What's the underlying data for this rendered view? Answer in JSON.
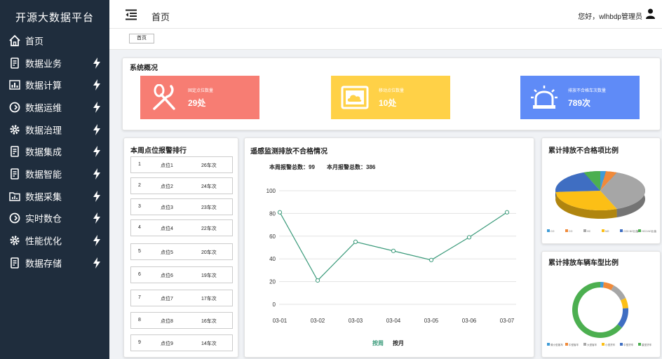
{
  "app": {
    "title": "开源大数据平台"
  },
  "sidebar": {
    "items": [
      {
        "label": "首页",
        "icon": "home-icon"
      },
      {
        "label": "数据业务",
        "icon": "document-icon"
      },
      {
        "label": "数据计算",
        "icon": "bar-chart-icon"
      },
      {
        "label": "数据运维",
        "icon": "refresh-icon"
      },
      {
        "label": "数据治理",
        "icon": "gear-icon"
      },
      {
        "label": "数据集成",
        "icon": "document-icon"
      },
      {
        "label": "数据智能",
        "icon": "document-icon"
      },
      {
        "label": "数据采集",
        "icon": "folder-chart-icon"
      },
      {
        "label": "实时数仓",
        "icon": "refresh-icon"
      },
      {
        "label": "性能优化",
        "icon": "gear-icon"
      },
      {
        "label": "数据存储",
        "icon": "document-icon"
      }
    ]
  },
  "header": {
    "title": "首页",
    "greeting": "您好，wlhbdp管理员"
  },
  "tagbar": {
    "tab": "首页"
  },
  "overview": {
    "title": "系统概况",
    "cards": [
      {
        "label": "固定点位数量",
        "value": "29处",
        "color": "#f77d73",
        "icon": "spoon-knife-icon"
      },
      {
        "label": "移动点位数量",
        "value": "10处",
        "color": "#ffd147",
        "icon": "cloud-screen-icon"
      },
      {
        "label": "排放不合格车次数量",
        "value": "789次",
        "color": "#5f8bf7",
        "icon": "alarm-light-icon"
      }
    ]
  },
  "ranking": {
    "title": "本周点位报警排行",
    "rows": [
      {
        "no": "1",
        "name": "点位1",
        "value": "26车次"
      },
      {
        "no": "2",
        "name": "点位2",
        "value": "24车次"
      },
      {
        "no": "3",
        "name": "点位3",
        "value": "23车次"
      },
      {
        "no": "4",
        "name": "点位4",
        "value": "22车次"
      },
      {
        "no": "5",
        "name": "点位5",
        "value": "20车次"
      },
      {
        "no": "6",
        "name": "点位6",
        "value": "19车次"
      },
      {
        "no": "7",
        "name": "点位7",
        "value": "17车次"
      },
      {
        "no": "8",
        "name": "点位8",
        "value": "16车次"
      },
      {
        "no": "9",
        "name": "点位9",
        "value": "14车次"
      }
    ]
  },
  "remote": {
    "title": "遥感监测排放不合格情况",
    "week_total": "本周报警总数：99",
    "month_total": "本月报警总数：386",
    "tabs": [
      "按周",
      "按月"
    ]
  },
  "chart_data": [
    {
      "type": "line",
      "x": [
        "03-01",
        "03-02",
        "03-03",
        "03-04",
        "03-05",
        "03-06",
        "03-07"
      ],
      "series": [
        {
          "values": [
            81,
            21,
            55,
            47,
            39,
            59,
            81
          ]
        }
      ],
      "ylim": [
        0,
        100
      ],
      "yticks": [
        "0",
        "20",
        "40",
        "60",
        "80",
        "100"
      ],
      "color": "#3a9a7a",
      "grid": true
    },
    {
      "title": "累计排放不合格项比例",
      "type": "pie",
      "values": [
        2,
        4,
        38,
        30,
        20,
        6
      ],
      "colors": [
        "#3f9bd6",
        "#f08a3a",
        "#a6a6a6",
        "#fcbf16",
        "#3f6ec2",
        "#4caf50"
      ],
      "legend": [
        "CO",
        "CO",
        "HC",
        "NO",
        "CO2-NO比值",
        "HC2-NO比值"
      ]
    },
    {
      "title": "累计排放车辆车型比例",
      "type": "pie",
      "values": [
        2,
        6,
        10,
        6,
        12,
        64
      ],
      "colors": [
        "#3f9bd6",
        "#f08a3a",
        "#a6a6a6",
        "#fcbf16",
        "#3f6ec2",
        "#4caf50"
      ],
      "legend": [
        "微小型客车",
        "中型客车",
        "大型客车",
        "小型货车",
        "中型货车",
        "重型货车"
      ]
    }
  ]
}
